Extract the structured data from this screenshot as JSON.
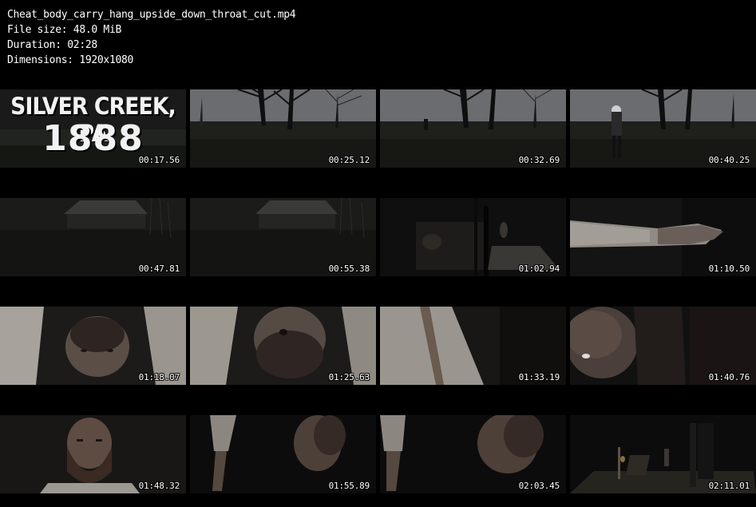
{
  "header": {
    "filename": "Cheat_body_carry_hang_upside_down_throat_cut.mp4",
    "file_size": "File size: 48.0 MiB",
    "duration": "Duration: 02:28",
    "dimensions": "Dimensions: 1920x1080"
  },
  "title_card": {
    "line1": "SILVER CREEK, PA",
    "line2": "1888"
  },
  "thumbnails": [
    {
      "timestamp": "00:17.56",
      "scene": "title-card"
    },
    {
      "timestamp": "00:25.12",
      "scene": "trees-field"
    },
    {
      "timestamp": "00:32.69",
      "scene": "trees-field-figure-far"
    },
    {
      "timestamp": "00:40.25",
      "scene": "trees-field-figure-near"
    },
    {
      "timestamp": "00:47.81",
      "scene": "dark-house"
    },
    {
      "timestamp": "00:55.38",
      "scene": "dark-house"
    },
    {
      "timestamp": "01:02.94",
      "scene": "barn-interior"
    },
    {
      "timestamp": "01:10.50",
      "scene": "arm-closeup"
    },
    {
      "timestamp": "01:18.07",
      "scene": "upside-down-face"
    },
    {
      "timestamp": "01:25.63",
      "scene": "upside-down-face"
    },
    {
      "timestamp": "01:33.19",
      "scene": "shirt-closeup"
    },
    {
      "timestamp": "01:40.76",
      "scene": "upside-down-face-dark"
    },
    {
      "timestamp": "01:48.32",
      "scene": "bearded-man"
    },
    {
      "timestamp": "01:55.89",
      "scene": "hanging-body"
    },
    {
      "timestamp": "02:03.45",
      "scene": "hanging-body"
    },
    {
      "timestamp": "02:11.01",
      "scene": "barn-wide"
    }
  ]
}
